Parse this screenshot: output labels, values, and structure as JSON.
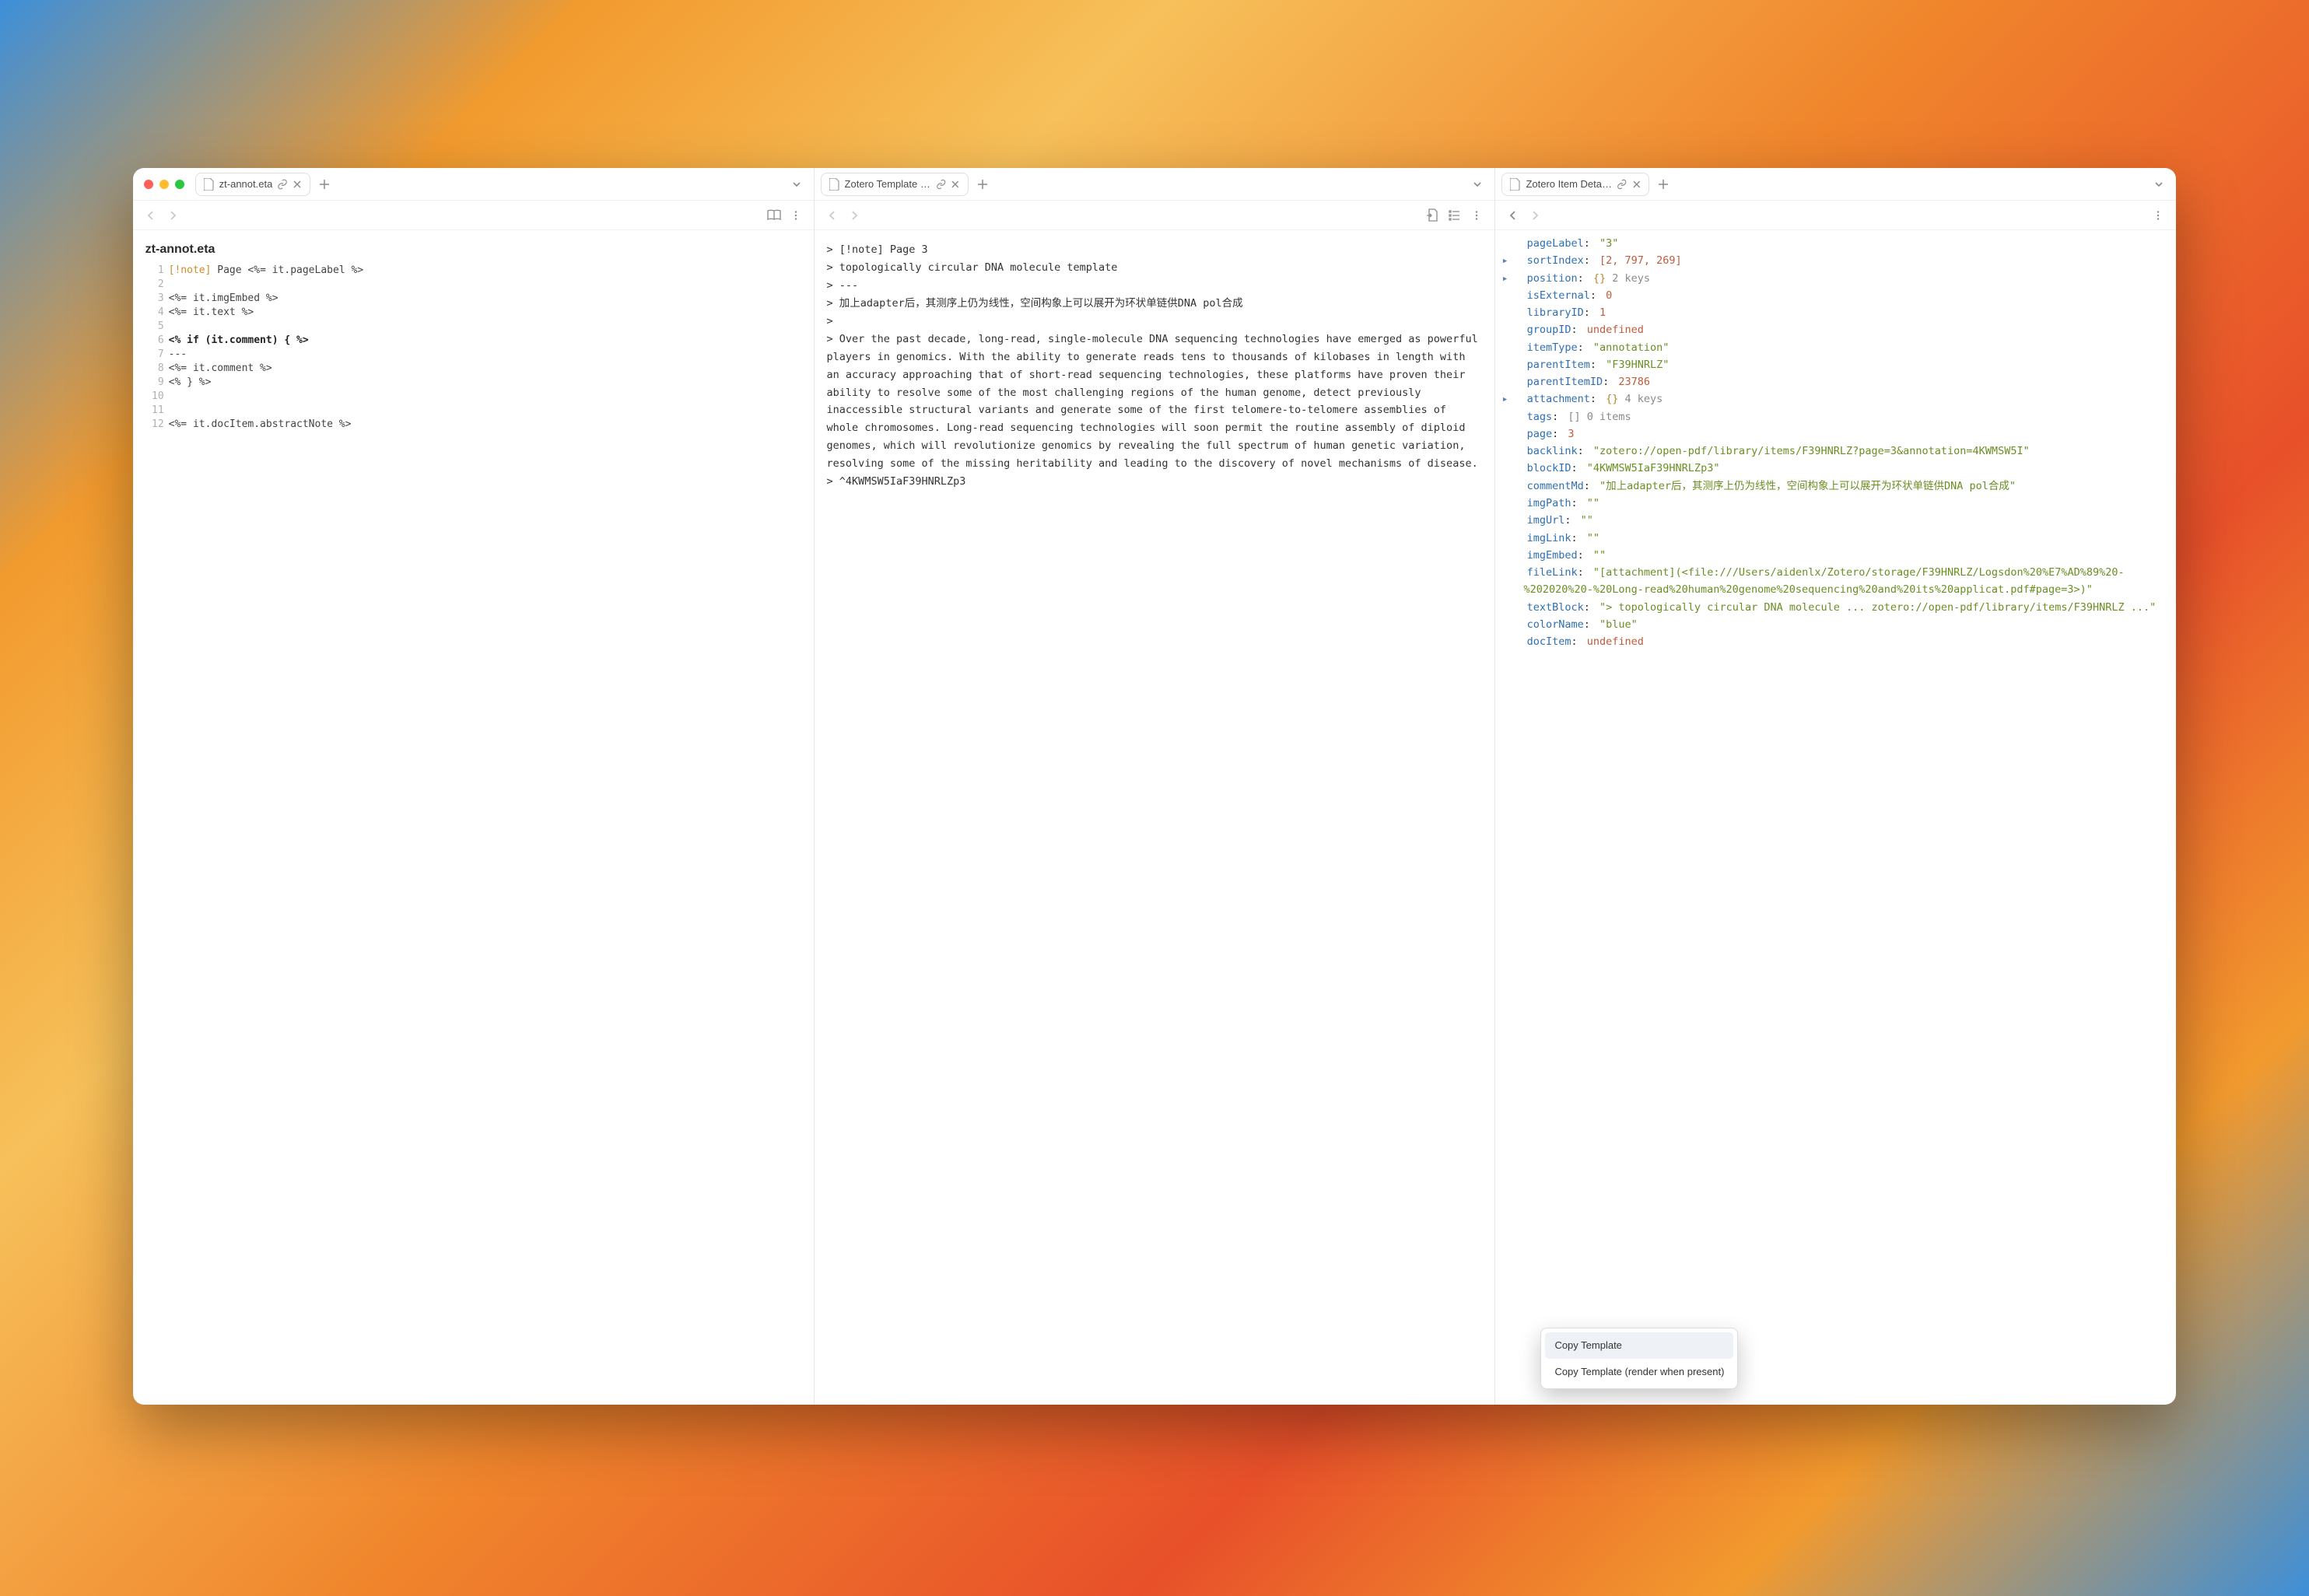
{
  "pane1": {
    "tab": {
      "title": "zt-annot.eta",
      "hasLink": true
    },
    "title": "zt-annot.eta",
    "lines": [
      {
        "n": 1,
        "markup": "[!note]",
        "rest": " Page <%= it.pageLabel %>"
      },
      {
        "n": 2,
        "rest": ""
      },
      {
        "n": 3,
        "rest": "<%= it.imgEmbed %>"
      },
      {
        "n": 4,
        "rest": "<%= it.text %>"
      },
      {
        "n": 5,
        "rest": ""
      },
      {
        "n": 6,
        "rest": "<% if (it.comment) { %>",
        "bold": true
      },
      {
        "n": 7,
        "rest": "---"
      },
      {
        "n": 8,
        "rest": "<%= it.comment %>"
      },
      {
        "n": 9,
        "rest": "<% } %>"
      },
      {
        "n": 10,
        "rest": ""
      },
      {
        "n": 11,
        "rest": ""
      },
      {
        "n": 12,
        "rest": "<%= it.docItem.abstractNote %>"
      }
    ]
  },
  "pane2": {
    "tab": {
      "title": "Zotero Template P...",
      "hasLink": true
    },
    "content": "> [!note] Page 3\n> topologically circular DNA molecule template\n> ---\n> 加上adapter后，其测序上仍为线性，空间构象上可以展开为环状单链供DNA pol合成\n>\n> Over the past decade, long-read, single-molecule DNA sequencing technologies have emerged as powerful players in genomics. With the ability to generate reads tens to thousands of kilobases in length with an accuracy approaching that of short-read sequencing technologies, these platforms have proven their ability to resolve some of the most challenging regions of the human genome, detect previously inaccessible structural variants and generate some of the first telomere-to-telomere assemblies of whole chromosomes. Long-read sequencing technologies will soon permit the routine assembly of diploid genomes, which will revolutionize genomics by revealing the full spectrum of human genetic variation, resolving some of the missing heritability and leading to the discovery of novel mechanisms of disease.\n> ^4KWMSW5IaF39HNRLZp3"
  },
  "pane3": {
    "tab": {
      "title": "Zotero Item Detail...",
      "hasLink": true
    },
    "items": [
      {
        "key": "pageLabel",
        "type": "str",
        "val": "\"3\""
      },
      {
        "key": "sortIndex",
        "type": "arr-exp",
        "triangle": true,
        "val": "[2, 797, 269]"
      },
      {
        "key": "position",
        "type": "obj-exp",
        "triangle": true,
        "val": "{} 2 keys"
      },
      {
        "key": "isExternal",
        "type": "num",
        "val": "0"
      },
      {
        "key": "libraryID",
        "type": "num",
        "val": "1"
      },
      {
        "key": "groupID",
        "type": "undef",
        "val": "undefined"
      },
      {
        "key": "itemType",
        "type": "str",
        "val": "\"annotation\""
      },
      {
        "key": "parentItem",
        "type": "str",
        "val": "\"F39HNRLZ\""
      },
      {
        "key": "parentItemID",
        "type": "num",
        "val": "23786"
      },
      {
        "key": "attachment",
        "type": "obj-exp",
        "triangle": true,
        "val": "{} 4 keys"
      },
      {
        "key": "tags",
        "type": "arr-empty",
        "val": "[] 0 items"
      },
      {
        "key": "page",
        "type": "num",
        "val": "3"
      },
      {
        "key": "backlink",
        "type": "str",
        "val": "\"zotero://open-pdf/library/items/F39HNRLZ?page=3&annotation=4KWMSW5I\""
      },
      {
        "key": "blockID",
        "type": "str",
        "val": "\"4KWMSW5IaF39HNRLZp3\""
      },
      {
        "key": "commentMd",
        "type": "str",
        "val": "\"加上adapter后，其测序上仍为线性，空间构象上可以展开为环状单链供DNA pol合成\""
      },
      {
        "key": "imgPath",
        "type": "str",
        "val": "\"\""
      },
      {
        "key": "imgUrl",
        "type": "str",
        "val": "\"\""
      },
      {
        "key": "imgLink",
        "type": "str",
        "val": "\"\""
      },
      {
        "key": "imgEmbed",
        "type": "str",
        "val": "\"\""
      },
      {
        "key": "fileLink",
        "type": "str",
        "val": "\"[attachment](<file:///Users/aidenlx/Zotero/storage/F39HNRLZ/Logsdon%20%E7%AD%89%20-%202020%20-%20Long-read%20human%20genome%20sequencing%20and%20its%20applicat.pdf#page=3>)\""
      },
      {
        "key": "textBlock",
        "type": "str-obscured",
        "val": "\"> topologically circular DNA molecule ... zotero://open-pdf/library/items/F39HNRLZ ...\"",
        "tail_frag": "r DNA mo\nlecule                                    y/items/F3\n9HNR"
      },
      {
        "key": "colorName",
        "type": "str",
        "val": "\"blue\""
      },
      {
        "key": "docItem",
        "type": "undef",
        "val": "undefined"
      }
    ],
    "contextMenu": {
      "items": [
        {
          "label": "Copy Template",
          "selected": true
        },
        {
          "label": "Copy Template (render when present)",
          "selected": false
        }
      ]
    }
  }
}
